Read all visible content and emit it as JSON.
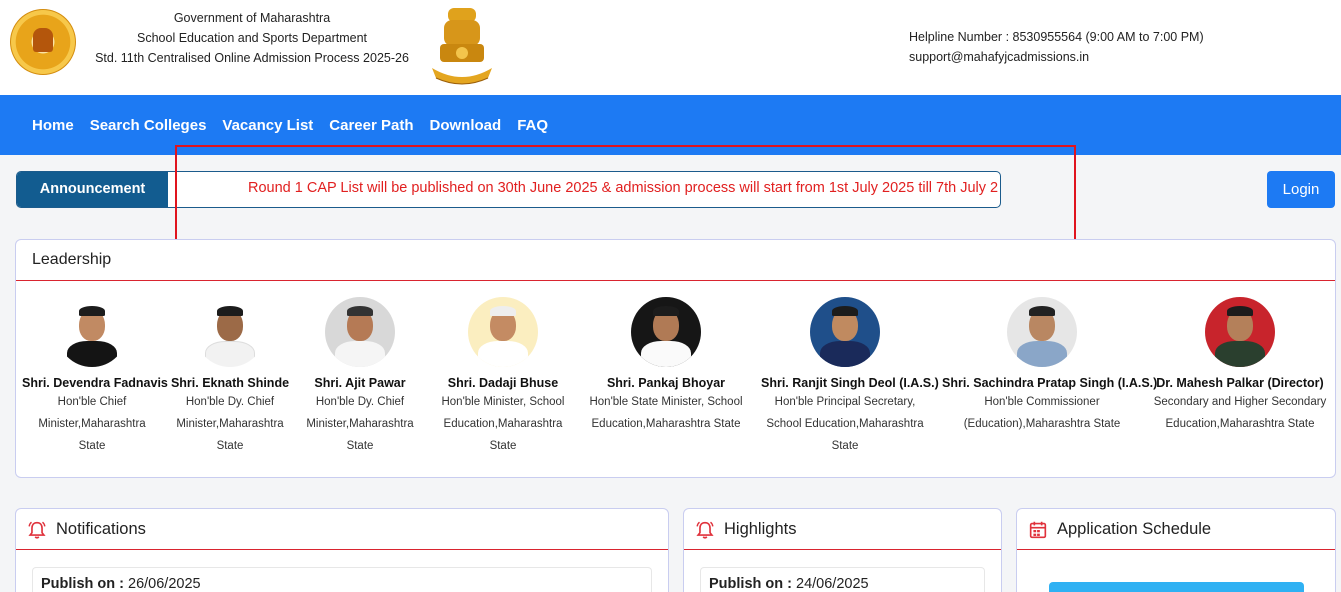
{
  "header": {
    "dept_lines": [
      "Government of Maharashtra",
      "School Education and Sports Department",
      "Std. 11th Centralised Online Admission Process 2025-26"
    ],
    "emblem_motto": "सत्यमेव जयते",
    "helpline": "Helpline Number : 8530955564 (9:00 AM to 7:00 PM)",
    "email": "support@mahafyjcadmissions.in"
  },
  "nav": {
    "items": [
      "Home",
      "Search Colleges",
      "Vacancy List",
      "Career Path",
      "Download",
      "FAQ"
    ]
  },
  "announcement": {
    "label": "Announcement",
    "text": "Round 1 CAP List will be published on 30th June 2025 & admission process will start from 1st July 2025 till 7th July 2"
  },
  "login_label": "Login",
  "leadership": {
    "title": "Leadership",
    "people": [
      {
        "name": "Shri. Devendra Fadnavis",
        "role_lines": [
          "Hon'ble Chief",
          "Minister,Maharashtra",
          "State"
        ]
      },
      {
        "name": "Shri. Eknath Shinde",
        "role_lines": [
          "Hon'ble Dy. Chief",
          "Minister,Maharashtra",
          "State"
        ]
      },
      {
        "name": "Shri. Ajit Pawar",
        "role_lines": [
          "Hon'ble Dy. Chief",
          "Minister,Maharashtra",
          "State"
        ]
      },
      {
        "name": "Shri. Dadaji Bhuse",
        "role_lines": [
          "Hon'ble Minister, School",
          "Education,Maharashtra",
          "State"
        ]
      },
      {
        "name": "Shri. Pankaj Bhoyar",
        "role_lines": [
          "Hon'ble State Minister, School",
          "Education,Maharashtra State"
        ]
      },
      {
        "name": "Shri. Ranjit Singh Deol (I.A.S.)",
        "role_lines": [
          "Hon'ble Principal Secretary,",
          "School Education,Maharashtra",
          "State"
        ]
      },
      {
        "name": "Shri. Sachindra Pratap Singh (I.A.S.)",
        "role_lines": [
          "Hon'ble Commissioner",
          "(Education),Maharashtra State"
        ]
      },
      {
        "name": "Dr. Mahesh Palkar (Director)",
        "role_lines": [
          "Secondary and Higher Secondary",
          "Education,Maharashtra State"
        ]
      }
    ]
  },
  "panels": {
    "notifications": {
      "title": "Notifications",
      "publish_label": "Publish on :",
      "publish_date": "26/06/2025"
    },
    "highlights": {
      "title": "Highlights",
      "publish_label": "Publish on :",
      "publish_date": "24/06/2025"
    },
    "schedule": {
      "title": "Application Schedule"
    }
  },
  "colors": {
    "nav_blue": "#1d7af3",
    "announce_label_bg": "#125c90",
    "announce_text": "#e12020",
    "highlight_box": "#e0141e",
    "section_rule": "#d9242f"
  }
}
